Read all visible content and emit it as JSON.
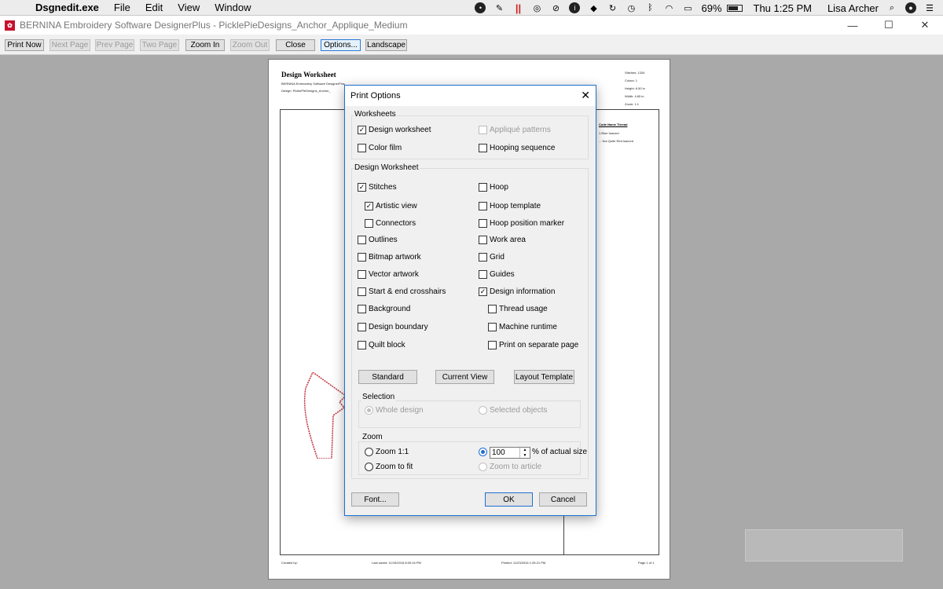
{
  "menubar": {
    "app_name": "Dsgnedit.exe",
    "menus": [
      "File",
      "Edit",
      "View",
      "Window"
    ],
    "battery": "69%",
    "clock": "Thu 1:25 PM",
    "user": "Lisa Archer"
  },
  "window": {
    "title": "BERNINA Embroidery Software DesignerPlus - PicklePieDesigns_Anchor_Applique_Medium",
    "minimize": "—",
    "maximize": "☐",
    "close": "✕"
  },
  "toolbar": {
    "buttons": [
      {
        "label": "Print Now"
      },
      {
        "label": "Next Page"
      },
      {
        "label": "Prev Page"
      },
      {
        "label": "Two Page"
      },
      {
        "label": "Zoom In"
      },
      {
        "label": "Zoom Out"
      },
      {
        "label": "Close"
      },
      {
        "label": "Options..."
      },
      {
        "label": "Landscape"
      }
    ]
  },
  "worksheet": {
    "title": "Design Worksheet",
    "line1": "BERNINA Embroidery Software DesignerPlus",
    "line2": "Design: PicklePieDesigns_Anchor_",
    "stats": [
      "Stitches: 1334",
      "Colors: 1",
      "Height: 6.50 in",
      "Width: 4.65 in",
      "Zoom: 1:1"
    ],
    "table_header": "Code  Name   Thread",
    "table_rows": [
      "1  Blue  Isacord",
      "... Not Quite Red  Isacord"
    ],
    "footer_created": "Created by:",
    "footer_saved": "Last saved: 11/19/2016 8:00:16 PM",
    "footer_printed": "Printed: 11/23/2016 1:25:21 PM",
    "footer_page": "Page 1 of 1"
  },
  "dialog": {
    "title": "Print Options",
    "close_glyph": "✕",
    "worksheets_group": "Worksheets",
    "worksheets": {
      "design_worksheet": {
        "label": "Design worksheet",
        "checked": true
      },
      "applique_patterns": {
        "label": "Appliqué patterns",
        "checked": false
      },
      "color_film": {
        "label": "Color film",
        "checked": false
      },
      "hooping_sequence": {
        "label": "Hooping sequence",
        "checked": false
      }
    },
    "design_group": "Design Worksheet",
    "options": {
      "stitches": {
        "label": "Stitches",
        "checked": true
      },
      "artistic_view": {
        "label": "Artistic view",
        "checked": true
      },
      "connectors": {
        "label": "Connectors",
        "checked": false
      },
      "outlines": {
        "label": "Outlines",
        "checked": false
      },
      "bitmap_artwork": {
        "label": "Bitmap artwork",
        "checked": false
      },
      "vector_artwork": {
        "label": "Vector artwork",
        "checked": false
      },
      "start_end": {
        "label": "Start & end crosshairs",
        "checked": false
      },
      "background": {
        "label": "Background",
        "checked": false
      },
      "design_boundary": {
        "label": "Design boundary",
        "checked": false
      },
      "quilt_block": {
        "label": "Quilt block",
        "checked": false
      },
      "hoop": {
        "label": "Hoop",
        "checked": false
      },
      "hoop_template": {
        "label": "Hoop template",
        "checked": false
      },
      "hoop_position_marker": {
        "label": "Hoop position marker",
        "checked": false
      },
      "work_area": {
        "label": "Work area",
        "checked": false
      },
      "grid": {
        "label": "Grid",
        "checked": false
      },
      "guides": {
        "label": "Guides",
        "checked": false
      },
      "design_information": {
        "label": "Design information",
        "checked": true
      },
      "thread_usage": {
        "label": "Thread usage",
        "checked": false
      },
      "machine_runtime": {
        "label": "Machine runtime",
        "checked": false
      },
      "print_separate": {
        "label": "Print on separate page",
        "checked": false
      }
    },
    "buttons": {
      "standard": "Standard",
      "current_view": "Current View",
      "layout_template": "Layout Template",
      "font": "Font...",
      "ok": "OK",
      "cancel": "Cancel"
    },
    "selection_group": "Selection",
    "selection": {
      "whole_design": {
        "label": "Whole design",
        "selected": true
      },
      "selected_objects": {
        "label": "Selected objects",
        "selected": false
      }
    },
    "zoom_group": "Zoom",
    "zoom": {
      "zoom_1_1": {
        "label": "Zoom 1:1",
        "selected": false
      },
      "zoom_to_fit": {
        "label": "Zoom to fit",
        "selected": false
      },
      "percent": {
        "selected": true,
        "value": "100",
        "suffix": "% of actual size"
      },
      "zoom_to_article": {
        "label": "Zoom to article",
        "selected": false
      }
    }
  },
  "colors": {
    "accent": "#1f6fd1",
    "stitch_red": "#c0303a",
    "bernina_red": "#c8102e"
  }
}
